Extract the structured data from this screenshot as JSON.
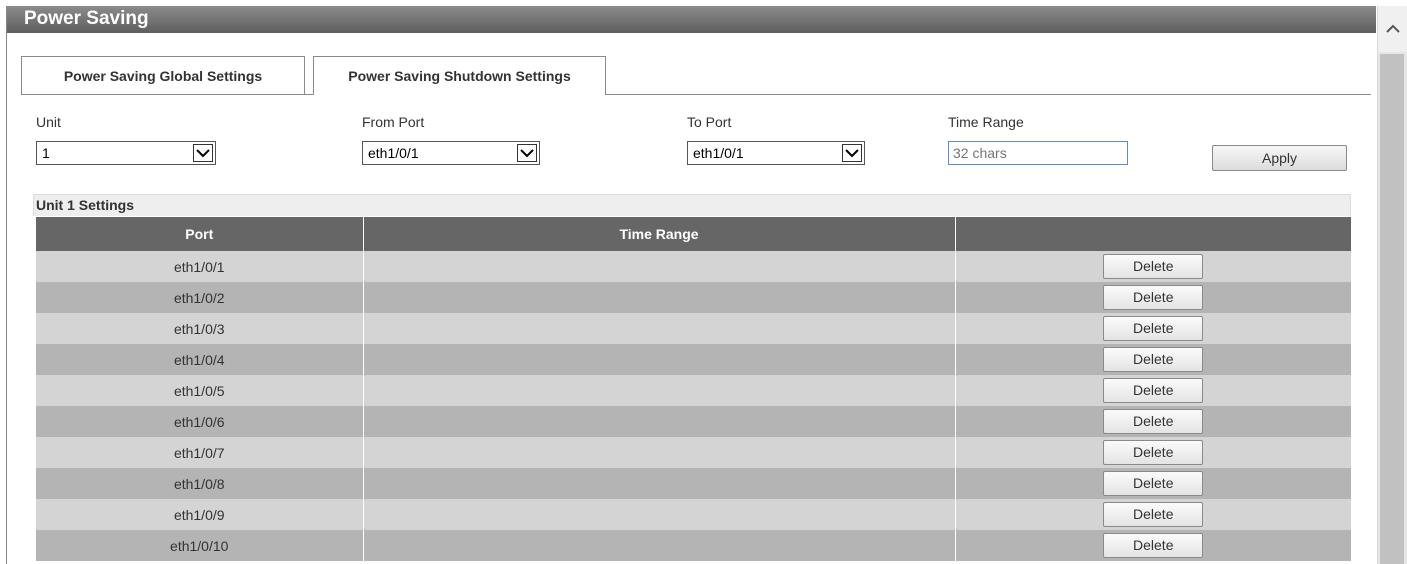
{
  "window": {
    "title": "Power Saving"
  },
  "tabs": [
    {
      "label": "Power Saving Global Settings",
      "active": false
    },
    {
      "label": "Power Saving Shutdown Settings",
      "active": true
    }
  ],
  "form": {
    "unit": {
      "label": "Unit",
      "value": "1"
    },
    "from_port": {
      "label": "From Port",
      "value": "eth1/0/1"
    },
    "to_port": {
      "label": "To Port",
      "value": "eth1/0/1"
    },
    "time_range": {
      "label": "Time Range",
      "placeholder": "32 chars",
      "value": ""
    },
    "apply_label": "Apply"
  },
  "section": {
    "title": "Unit 1 Settings"
  },
  "table": {
    "columns": [
      "Port",
      "Time Range",
      ""
    ],
    "rows": [
      {
        "port": "eth1/0/1",
        "time_range": "",
        "action": "Delete"
      },
      {
        "port": "eth1/0/2",
        "time_range": "",
        "action": "Delete"
      },
      {
        "port": "eth1/0/3",
        "time_range": "",
        "action": "Delete"
      },
      {
        "port": "eth1/0/4",
        "time_range": "",
        "action": "Delete"
      },
      {
        "port": "eth1/0/5",
        "time_range": "",
        "action": "Delete"
      },
      {
        "port": "eth1/0/6",
        "time_range": "",
        "action": "Delete"
      },
      {
        "port": "eth1/0/7",
        "time_range": "",
        "action": "Delete"
      },
      {
        "port": "eth1/0/8",
        "time_range": "",
        "action": "Delete"
      },
      {
        "port": "eth1/0/9",
        "time_range": "",
        "action": "Delete"
      },
      {
        "port": "eth1/0/10",
        "time_range": "",
        "action": "Delete"
      }
    ]
  },
  "colors": {
    "title_bar": "#6e6e6e",
    "table_header": "#666666",
    "row_light": "#d4d4d4",
    "row_dark": "#b4b4b4",
    "input_border_focus": "#5b8ccf"
  },
  "icons": {
    "scroll_up": "chevron-up-icon",
    "dropdown": "chevron-down-icon"
  }
}
